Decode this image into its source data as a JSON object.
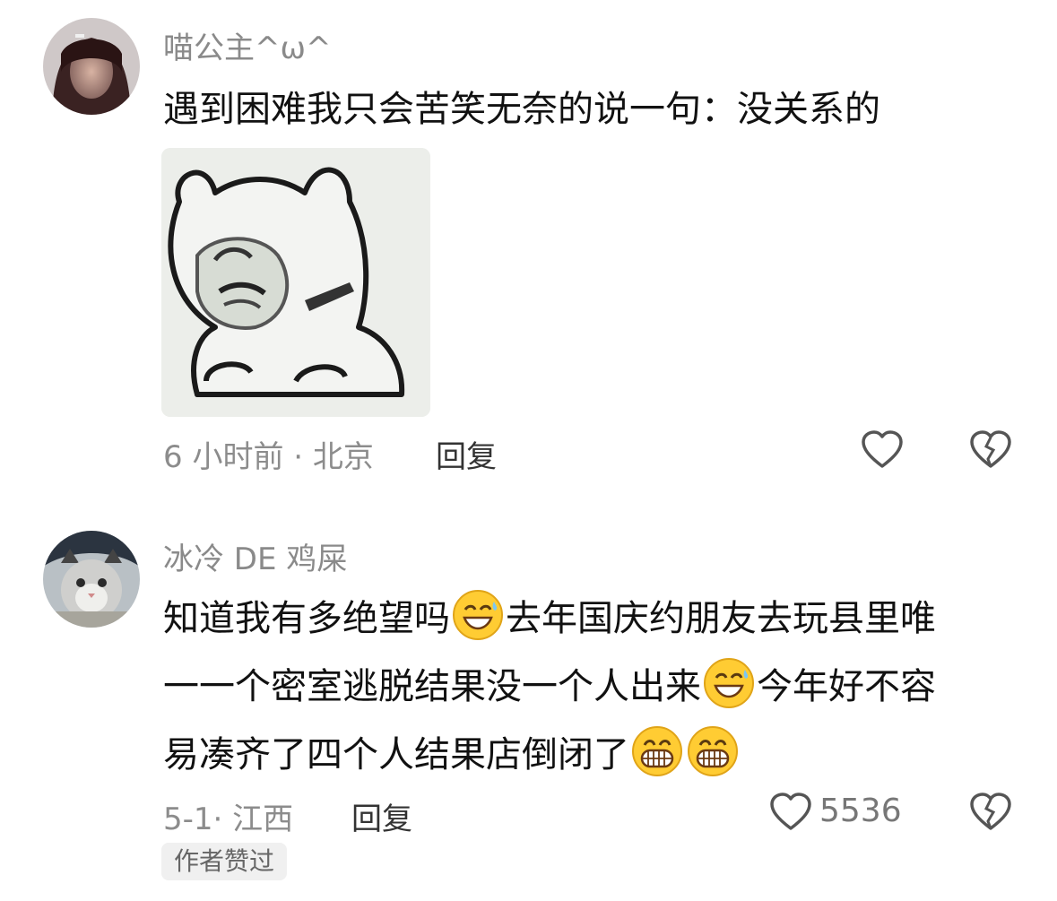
{
  "comments": [
    {
      "username": "喵公主^ω^",
      "text": "遇到困难我只会苦笑无奈的说一句：没关系的",
      "meta": "6 小时前 · 北京",
      "reply": "回复"
    },
    {
      "username": "冰冷 DE 鸡屎",
      "lines": [
        {
          "a": "知道我有多绝望吗",
          "b": "去年国庆约朋友去玩县里唯"
        },
        {
          "a": "一一个密室逃脱结果没一个人出来",
          "b": "今年好不容"
        },
        {
          "a": "易凑齐了四个人结果店倒闭了",
          "b": ""
        }
      ],
      "meta": "5-1· 江西",
      "reply": "回复",
      "like_count": "5536",
      "badge": "作者赞过"
    }
  ],
  "icons": {
    "like": "heart-outline-icon",
    "dislike": "broken-heart-icon",
    "emoji_smile": "grin-sweat-emoji",
    "emoji_grin": "big-grin-emoji"
  },
  "colors": {
    "username": "#8a8a8a",
    "meta": "#8c8c8c",
    "text": "#111111"
  }
}
